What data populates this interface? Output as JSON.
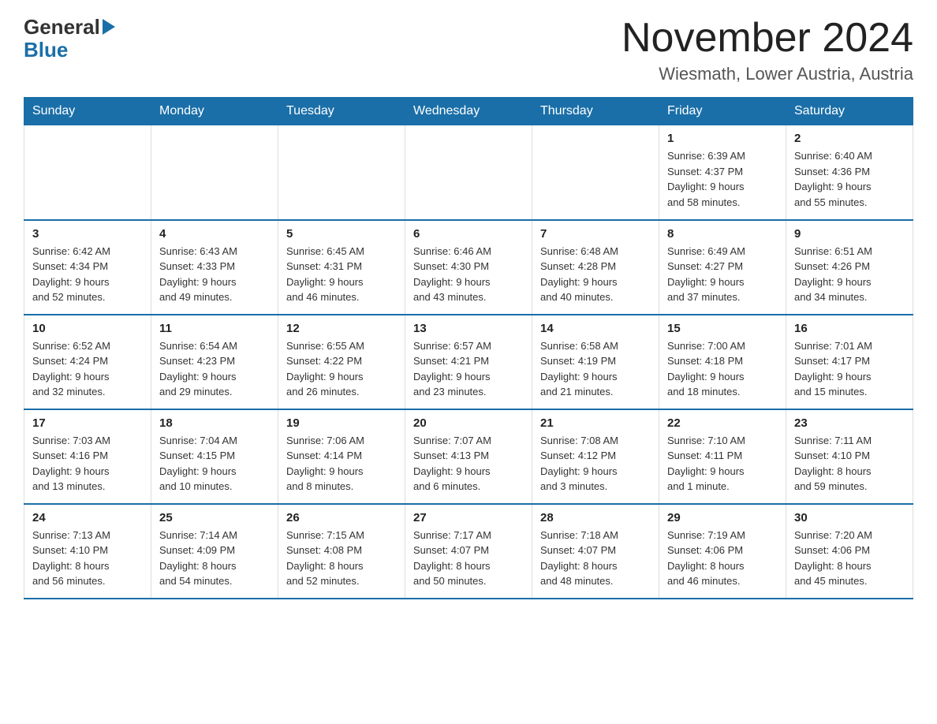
{
  "header": {
    "logo_general": "General",
    "logo_blue": "Blue",
    "month_title": "November 2024",
    "location": "Wiesmath, Lower Austria, Austria"
  },
  "weekdays": [
    "Sunday",
    "Monday",
    "Tuesday",
    "Wednesday",
    "Thursday",
    "Friday",
    "Saturday"
  ],
  "weeks": [
    [
      {
        "day": "",
        "info": ""
      },
      {
        "day": "",
        "info": ""
      },
      {
        "day": "",
        "info": ""
      },
      {
        "day": "",
        "info": ""
      },
      {
        "day": "",
        "info": ""
      },
      {
        "day": "1",
        "info": "Sunrise: 6:39 AM\nSunset: 4:37 PM\nDaylight: 9 hours\nand 58 minutes."
      },
      {
        "day": "2",
        "info": "Sunrise: 6:40 AM\nSunset: 4:36 PM\nDaylight: 9 hours\nand 55 minutes."
      }
    ],
    [
      {
        "day": "3",
        "info": "Sunrise: 6:42 AM\nSunset: 4:34 PM\nDaylight: 9 hours\nand 52 minutes."
      },
      {
        "day": "4",
        "info": "Sunrise: 6:43 AM\nSunset: 4:33 PM\nDaylight: 9 hours\nand 49 minutes."
      },
      {
        "day": "5",
        "info": "Sunrise: 6:45 AM\nSunset: 4:31 PM\nDaylight: 9 hours\nand 46 minutes."
      },
      {
        "day": "6",
        "info": "Sunrise: 6:46 AM\nSunset: 4:30 PM\nDaylight: 9 hours\nand 43 minutes."
      },
      {
        "day": "7",
        "info": "Sunrise: 6:48 AM\nSunset: 4:28 PM\nDaylight: 9 hours\nand 40 minutes."
      },
      {
        "day": "8",
        "info": "Sunrise: 6:49 AM\nSunset: 4:27 PM\nDaylight: 9 hours\nand 37 minutes."
      },
      {
        "day": "9",
        "info": "Sunrise: 6:51 AM\nSunset: 4:26 PM\nDaylight: 9 hours\nand 34 minutes."
      }
    ],
    [
      {
        "day": "10",
        "info": "Sunrise: 6:52 AM\nSunset: 4:24 PM\nDaylight: 9 hours\nand 32 minutes."
      },
      {
        "day": "11",
        "info": "Sunrise: 6:54 AM\nSunset: 4:23 PM\nDaylight: 9 hours\nand 29 minutes."
      },
      {
        "day": "12",
        "info": "Sunrise: 6:55 AM\nSunset: 4:22 PM\nDaylight: 9 hours\nand 26 minutes."
      },
      {
        "day": "13",
        "info": "Sunrise: 6:57 AM\nSunset: 4:21 PM\nDaylight: 9 hours\nand 23 minutes."
      },
      {
        "day": "14",
        "info": "Sunrise: 6:58 AM\nSunset: 4:19 PM\nDaylight: 9 hours\nand 21 minutes."
      },
      {
        "day": "15",
        "info": "Sunrise: 7:00 AM\nSunset: 4:18 PM\nDaylight: 9 hours\nand 18 minutes."
      },
      {
        "day": "16",
        "info": "Sunrise: 7:01 AM\nSunset: 4:17 PM\nDaylight: 9 hours\nand 15 minutes."
      }
    ],
    [
      {
        "day": "17",
        "info": "Sunrise: 7:03 AM\nSunset: 4:16 PM\nDaylight: 9 hours\nand 13 minutes."
      },
      {
        "day": "18",
        "info": "Sunrise: 7:04 AM\nSunset: 4:15 PM\nDaylight: 9 hours\nand 10 minutes."
      },
      {
        "day": "19",
        "info": "Sunrise: 7:06 AM\nSunset: 4:14 PM\nDaylight: 9 hours\nand 8 minutes."
      },
      {
        "day": "20",
        "info": "Sunrise: 7:07 AM\nSunset: 4:13 PM\nDaylight: 9 hours\nand 6 minutes."
      },
      {
        "day": "21",
        "info": "Sunrise: 7:08 AM\nSunset: 4:12 PM\nDaylight: 9 hours\nand 3 minutes."
      },
      {
        "day": "22",
        "info": "Sunrise: 7:10 AM\nSunset: 4:11 PM\nDaylight: 9 hours\nand 1 minute."
      },
      {
        "day": "23",
        "info": "Sunrise: 7:11 AM\nSunset: 4:10 PM\nDaylight: 8 hours\nand 59 minutes."
      }
    ],
    [
      {
        "day": "24",
        "info": "Sunrise: 7:13 AM\nSunset: 4:10 PM\nDaylight: 8 hours\nand 56 minutes."
      },
      {
        "day": "25",
        "info": "Sunrise: 7:14 AM\nSunset: 4:09 PM\nDaylight: 8 hours\nand 54 minutes."
      },
      {
        "day": "26",
        "info": "Sunrise: 7:15 AM\nSunset: 4:08 PM\nDaylight: 8 hours\nand 52 minutes."
      },
      {
        "day": "27",
        "info": "Sunrise: 7:17 AM\nSunset: 4:07 PM\nDaylight: 8 hours\nand 50 minutes."
      },
      {
        "day": "28",
        "info": "Sunrise: 7:18 AM\nSunset: 4:07 PM\nDaylight: 8 hours\nand 48 minutes."
      },
      {
        "day": "29",
        "info": "Sunrise: 7:19 AM\nSunset: 4:06 PM\nDaylight: 8 hours\nand 46 minutes."
      },
      {
        "day": "30",
        "info": "Sunrise: 7:20 AM\nSunset: 4:06 PM\nDaylight: 8 hours\nand 45 minutes."
      }
    ]
  ]
}
